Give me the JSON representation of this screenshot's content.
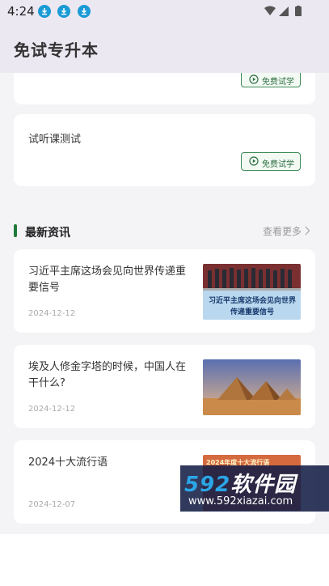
{
  "status": {
    "time": "4:24"
  },
  "header": {
    "title": "免试专升本"
  },
  "courses": [
    {
      "name": "",
      "button": "免费试学"
    },
    {
      "name": "试听课测试",
      "button": "免费试学"
    }
  ],
  "news_section": {
    "title": "最新资讯",
    "more": "查看更多"
  },
  "news": [
    {
      "title": "习近平主席这场会见向世界传递重要信号",
      "date": "2024-12-12",
      "thumb_caption": "习近平主席这场会见向世界传递重要信号"
    },
    {
      "title": "埃及人修金字塔的时候，中国人在干什么?",
      "date": "2024-12-12"
    },
    {
      "title": "2024十大流行语",
      "date": "2024-12-07",
      "thumb_caption": "2024年度十大流行语"
    }
  ],
  "watermark": {
    "brand_num": "592",
    "brand_cn": "软件园",
    "url": "www.592xiazai.com"
  },
  "colors": {
    "accent_green": "#1f7a3a",
    "header_bg": "#ece8f1",
    "download_blue": "#1a9ad6"
  }
}
